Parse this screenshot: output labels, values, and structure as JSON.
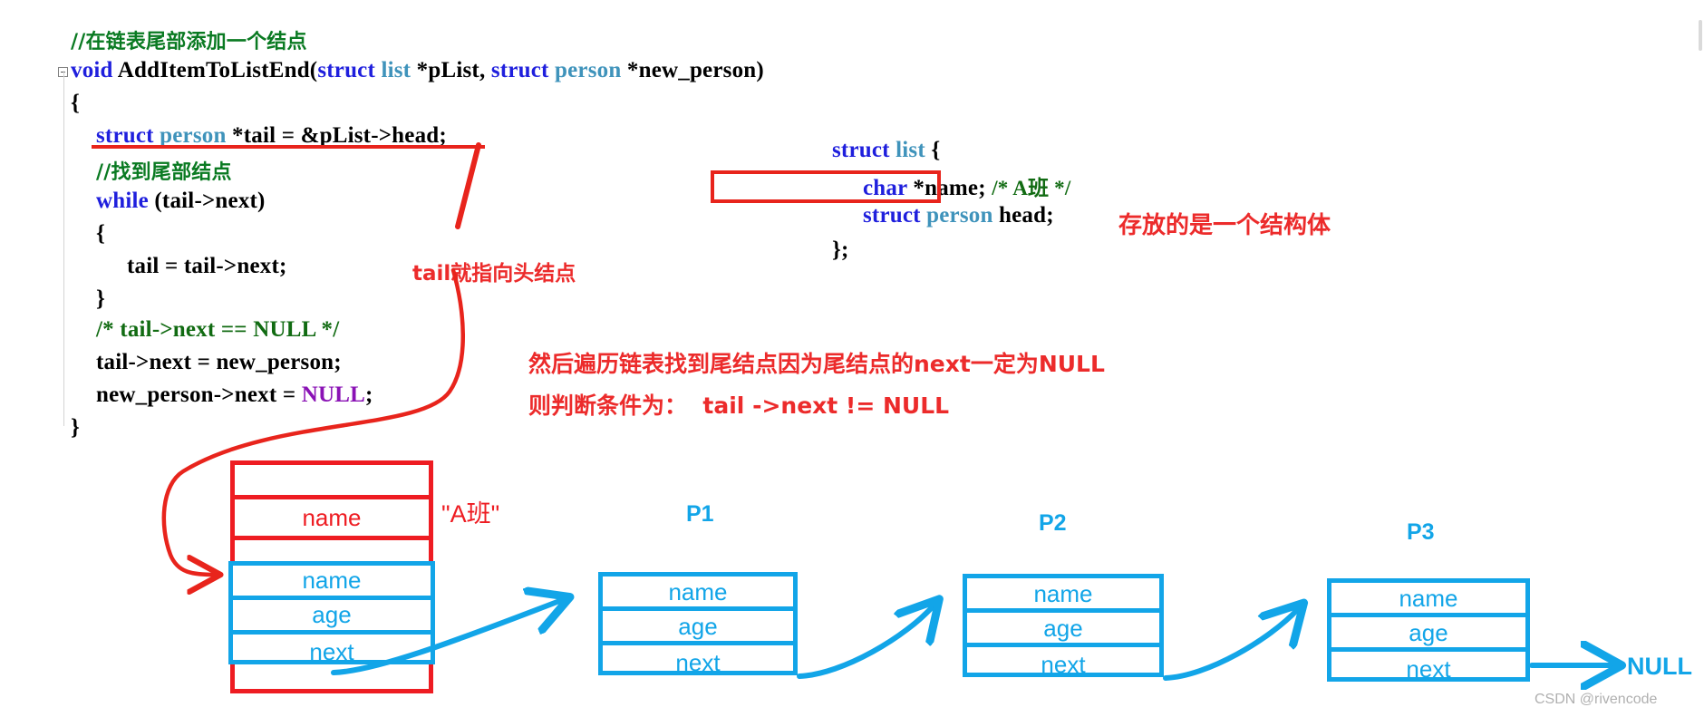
{
  "code": {
    "comment_top": "//在链表尾部添加一个结点",
    "signature": {
      "ret": "void",
      "name": " AddItemToListEnd(",
      "kw1": "struct",
      "typ1": " list",
      "mid": " *pList, ",
      "kw2": "struct",
      "typ2": " person",
      "tail": " *new_person)"
    },
    "brace_open": "{",
    "decl": {
      "kw": "struct",
      "typ": " person",
      "rest": " *tail = &pList->head;"
    },
    "comment_find_tail": "//找到尾部结点",
    "while_kw": "while",
    "while_cond": " (tail->next)",
    "inner_open": "{",
    "assign": "tail = tail->next;",
    "inner_close": "}",
    "comment_null": "/* tail->next == NULL */",
    "stmt_link": "tail->next = new_person;",
    "stmt_null_a": "new_person->next = ",
    "stmt_null_b": "NULL",
    "stmt_null_c": ";",
    "brace_close": "}"
  },
  "struct_block": {
    "line1_kw": "struct",
    "line1_typ": " list",
    "line1_brace": " {",
    "line2_kw": "char",
    "line2_rest": " *name; ",
    "line2_cmt": "/* A班 */",
    "line3_kw": "struct",
    "line3_typ": " person",
    "line3_rest": " head;",
    "line4": "};"
  },
  "annotations": {
    "tail_points_head": "tail就指向头结点",
    "stores_struct": "存放的是一个结构体",
    "traverse_line1": "然后遍历链表找到尾结点因为尾结点的next一定为NULL",
    "traverse_line2": "则判断条件为：  tail ->next != NULL"
  },
  "diagram": {
    "head_node": {
      "outer_rows": [
        "",
        "name",
        ""
      ],
      "inner_rows": [
        "name",
        "age",
        "next"
      ],
      "value_label": "\"A班\""
    },
    "nodes": [
      {
        "label": "P1",
        "rows": [
          "name",
          "age",
          "next"
        ]
      },
      {
        "label": "P2",
        "rows": [
          "name",
          "age",
          "next"
        ]
      },
      {
        "label": "P3",
        "rows": [
          "name",
          "age",
          "next"
        ]
      }
    ],
    "terminator": "NULL"
  },
  "watermark": "CSDN @rivencode",
  "colors": {
    "blue": "#12a5e8",
    "red": "#ee1c22",
    "annotation_red": "#ec2b2b",
    "keyword_blue": "#1f1fdd",
    "type_teal": "#3f93bb",
    "comment_green": "#0a7a22",
    "null_purple": "#8a12b5"
  }
}
